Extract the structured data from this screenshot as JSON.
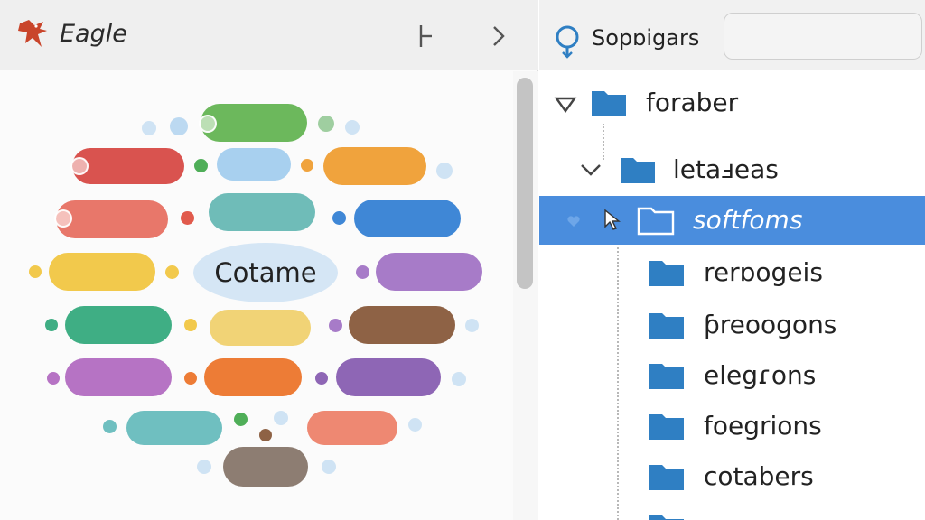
{
  "app": {
    "title": "Eagle",
    "logo_icon": "eagle-logo-icon",
    "split_icon": "split-view-icon",
    "forward_icon": "chevron-right-icon"
  },
  "canvas": {
    "center_label": "Cotame",
    "pill_colors": [
      "#6cb85c",
      "#d9534f",
      "#a8d0ef",
      "#f0a33d",
      "#e8776a",
      "#6fbcb8",
      "#3f87d6",
      "#f2c94c",
      "#a77bc8",
      "#3fae84",
      "#f1d376",
      "#8e6245",
      "#b673c4",
      "#ed7c36",
      "#8e66b5",
      "#6fbfc0",
      "#ee8872",
      "#8d7d72"
    ]
  },
  "search": {
    "label": "Sopɒigars",
    "placeholder": "",
    "icon": "search-icon"
  },
  "tree": {
    "items": [
      {
        "label": "foraber",
        "expanded": true,
        "icon": "folder-icon"
      },
      {
        "label": "letaⅎeas",
        "expanded": true,
        "icon": "folder-icon"
      },
      {
        "label": "softfoms",
        "expanded": false,
        "selected": true,
        "icon": "folder-open-icon"
      },
      {
        "label": "rerɒogeis",
        "icon": "folder-icon"
      },
      {
        "label": "ƥreoogons",
        "icon": "folder-icon"
      },
      {
        "label": "elegɾons",
        "icon": "folder-icon"
      },
      {
        "label": "foegrions",
        "icon": "folder-icon"
      },
      {
        "label": "cotabers",
        "icon": "folder-icon"
      }
    ]
  },
  "colors": {
    "accent": "#4a8ddd",
    "folder": "#2f7fc3"
  }
}
